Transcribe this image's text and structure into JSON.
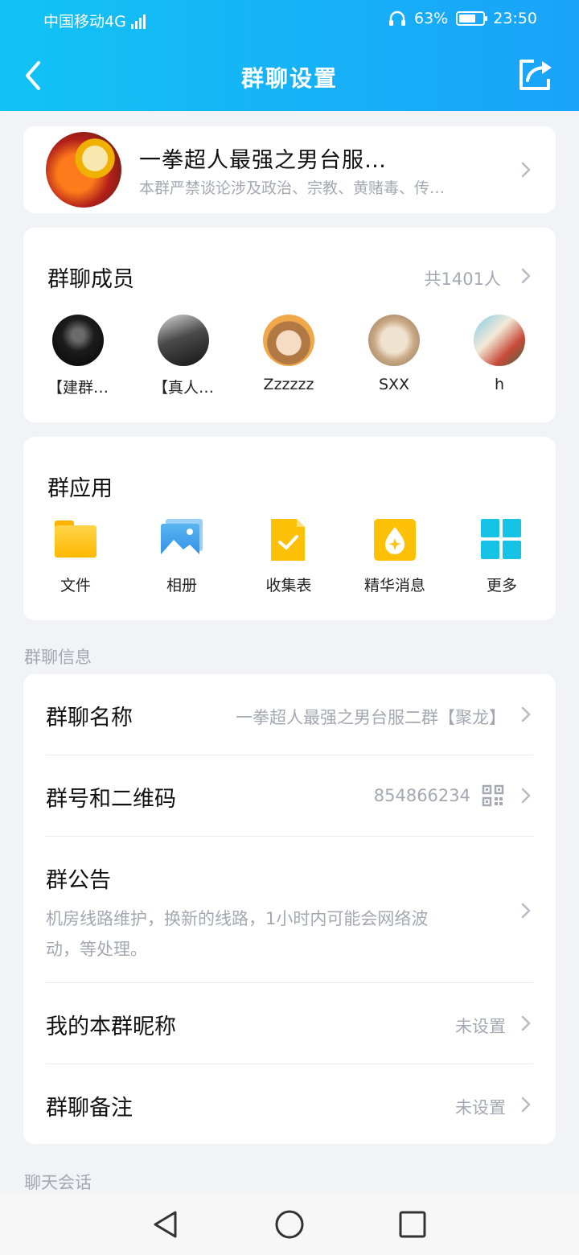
{
  "status_bar": {
    "carrier": "中国移动4G",
    "battery": "63%",
    "time": "23:50",
    "battery_level": 0.63
  },
  "nav": {
    "title": "群聊设置",
    "back_icon": "chevron-left-icon",
    "share_icon": "share-icon"
  },
  "group": {
    "name": "一拳超人最强之男台服…",
    "description": "本群严禁谈论涉及政治、宗教、黄赌毒、传…"
  },
  "members": {
    "title": "群聊成员",
    "count": "共1401人",
    "list": [
      {
        "name": "【建群…"
      },
      {
        "name": "【真人…"
      },
      {
        "name": "Zzzzzz"
      },
      {
        "name": "SXX"
      },
      {
        "name": "h"
      }
    ]
  },
  "apps": {
    "title": "群应用",
    "items": [
      {
        "label": "文件",
        "icon": "folder-icon"
      },
      {
        "label": "相册",
        "icon": "photo-album-icon"
      },
      {
        "label": "收集表",
        "icon": "form-icon"
      },
      {
        "label": "精华消息",
        "icon": "essence-icon"
      },
      {
        "label": "更多",
        "icon": "grid-more-icon"
      }
    ]
  },
  "info": {
    "section_label": "群聊信息",
    "name_label": "群聊名称",
    "name_value": "一拳超人最强之男台服二群【聚龙】",
    "number_label": "群号和二维码",
    "number_value": "854866234",
    "notice_label": "群公告",
    "notice_line1": "机房线路维护，换新的线路，1小时内可能会网络波",
    "notice_line2": "动，等处理。",
    "nickname_label": "我的本群昵称",
    "nickname_value": "未设置",
    "remark_label": "群聊备注",
    "remark_value": "未设置"
  },
  "chat": {
    "section_label": "聊天会话"
  },
  "system_nav": {
    "back_icon": "triangle-back-icon",
    "home_icon": "circle-home-icon",
    "recents_icon": "square-recents-icon"
  }
}
